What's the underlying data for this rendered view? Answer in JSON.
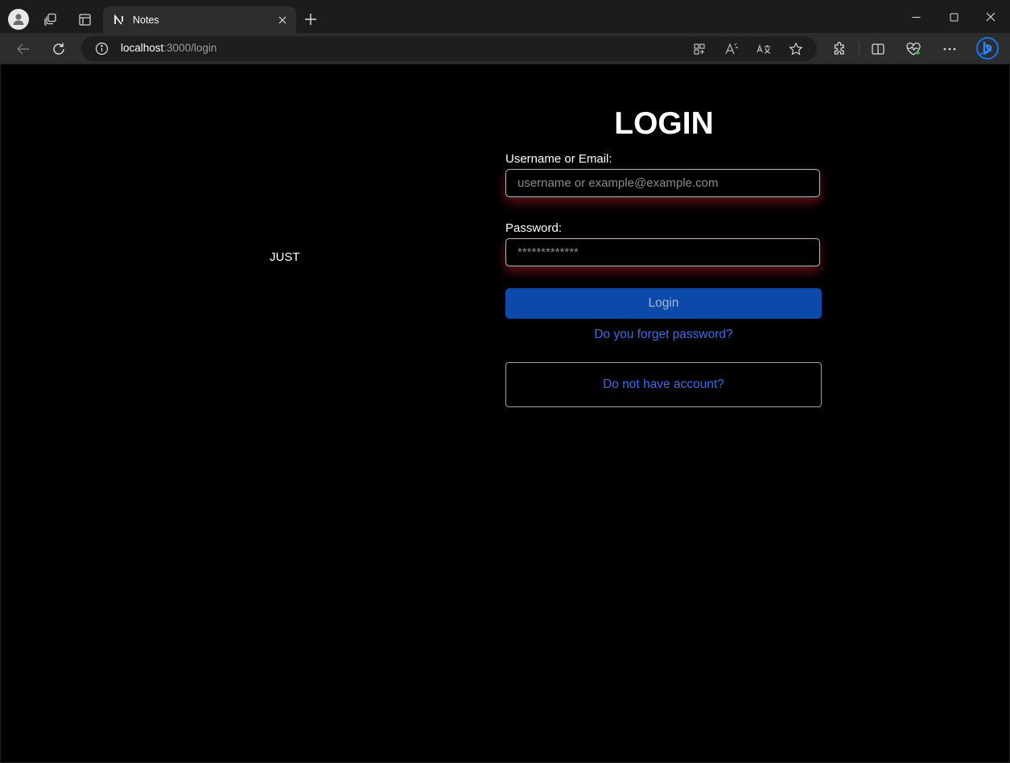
{
  "browser": {
    "tab": {
      "title": "Notes"
    },
    "address": {
      "host": "localhost",
      "path": ":3000/login"
    }
  },
  "page": {
    "side_text": "JUST",
    "title": "LOGIN",
    "username": {
      "label": "Username or Email:",
      "placeholder": "username or example@example.com",
      "value": ""
    },
    "password": {
      "label": "Password:",
      "placeholder": "*************",
      "value": ""
    },
    "login_button": "Login",
    "forgot_link": "Do you forget password?",
    "signup_link": "Do not have account?"
  },
  "colors": {
    "page_background": "#000000",
    "button_primary": "#0b4aaa",
    "link": "#2f6ff0",
    "field_glow": "#be1e2d"
  }
}
